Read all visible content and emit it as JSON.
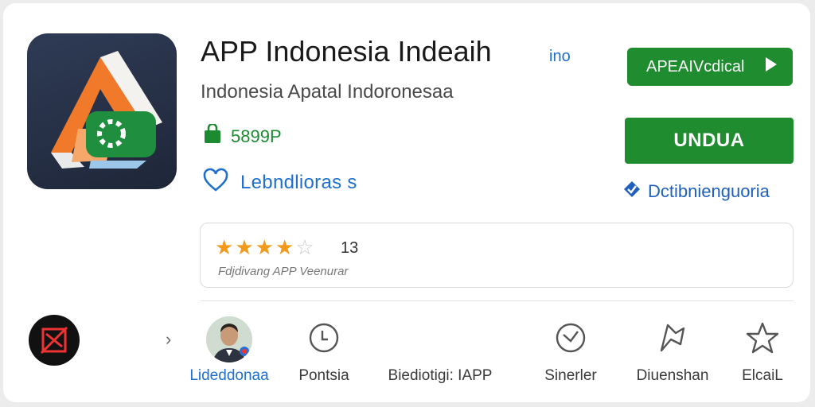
{
  "app": {
    "name": "APP Indonesia Indeaih",
    "name_tag": "ino",
    "developer": "Indonesia Apatal Indoronesaa",
    "size": "5899P",
    "favorite_label": "Lebndlioras s"
  },
  "actions": {
    "primary_label": "APEAIVcdical",
    "install_label": "UNDUA",
    "secure_label": "Dctibnienguoria"
  },
  "rating": {
    "stars": 3.5,
    "count": "13",
    "caption": "Fdjdivang APP Veenurar"
  },
  "nav": {
    "items": [
      {
        "label": "Lideddonaa",
        "icon": "avatar",
        "active": true
      },
      {
        "label": "Pontsia",
        "icon": "clock-icon",
        "active": false
      },
      {
        "label": "Biediotigi: IAPP",
        "icon": "",
        "active": false
      },
      {
        "label": "Sinerler",
        "icon": "check-circle-icon",
        "active": false
      },
      {
        "label": "Diuenshan",
        "icon": "flag-icon",
        "active": false
      },
      {
        "label": "ElcaiL",
        "icon": "star-icon",
        "active": false
      }
    ]
  },
  "colors": {
    "accent_green": "#1e8c2f",
    "link_blue": "#1f6fd0",
    "star_orange": "#f29a1c",
    "icon_bg": "#2a344d",
    "icon_orange": "#f07a2a"
  }
}
